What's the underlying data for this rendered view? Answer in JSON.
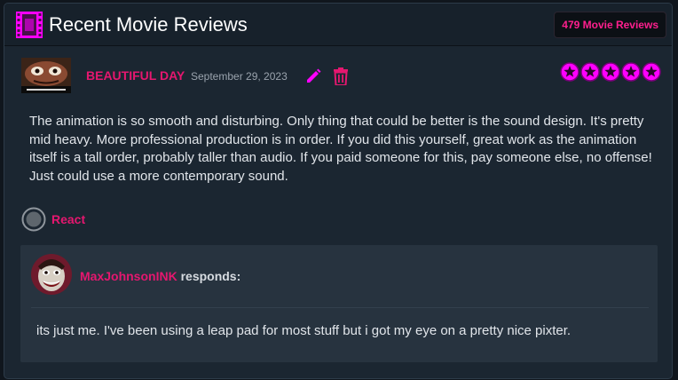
{
  "header": {
    "title": "Recent Movie Reviews",
    "icon": "film-icon",
    "count_badge": "479 Movie Reviews"
  },
  "review": {
    "reviewer_name": "BEAUTIFUL DAY",
    "date": "September 29, 2023",
    "rating": 5,
    "rating_max": 5,
    "body": "The animation is so smooth and disturbing. Only thing that could be better is the sound design. It's pretty mid heavy. More professional production is in order. If you did this yourself, great work as the animation itself is a tall order, probably taller than audio. If you paid someone for this, pay someone else, no offense! Just could use a more contemporary sound.",
    "react_label": "React",
    "actions": [
      "pencil-icon",
      "trash-icon"
    ]
  },
  "response": {
    "responder_name": "MaxJohnsonINK",
    "responds_label": "responds:",
    "text": "its just me. I've been using a leap pad for most stuff but i got my eye on a pretty nice pixter."
  },
  "colors": {
    "accent": "#e5176f",
    "badge_text": "#ff1f8e",
    "star_fill": "#ff00ff",
    "panel_bg": "#1b2631",
    "response_bg": "#27333f"
  }
}
